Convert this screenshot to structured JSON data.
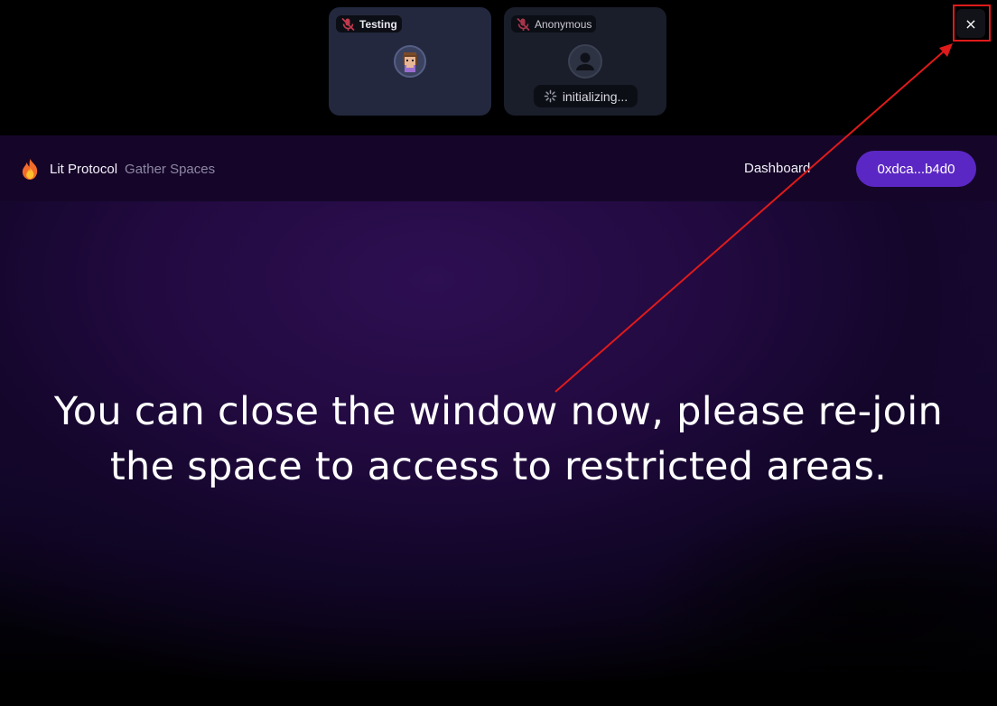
{
  "participants": [
    {
      "name": "Testing",
      "status": ""
    },
    {
      "name": "Anonymous",
      "status": "initializing..."
    }
  ],
  "close_label": "×",
  "navbar": {
    "brand": "Lit Protocol",
    "product": "Gather Spaces",
    "dashboard_link": "Dashboard",
    "wallet_address": "0xdca...b4d0"
  },
  "main": {
    "message_line1": "You can close the window now, please re-join",
    "message_line2": "the space to access to restricted areas."
  },
  "colors": {
    "accent": "#5b27c4",
    "annotation": "#e01a1a",
    "background": "#1e0a3c"
  },
  "icons": [
    "mic-off-icon",
    "avatar-icon",
    "user-placeholder-icon",
    "spinner-icon",
    "close-icon",
    "flame-logo-icon"
  ]
}
